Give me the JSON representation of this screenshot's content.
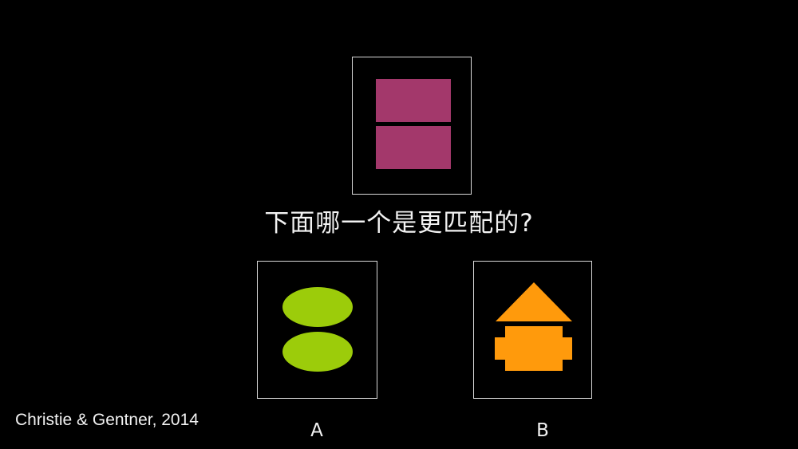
{
  "question": "下面哪一个是更匹配的?",
  "choices": {
    "a_label": "A",
    "b_label": "B"
  },
  "citation": "Christie & Gentner, 2014",
  "figures": {
    "target": {
      "shape": "two stacked rectangles",
      "color": "#a3386b"
    },
    "option_a": {
      "shape": "two stacked ellipses",
      "color": "#9ccc0a"
    },
    "option_b": {
      "shape": "triangle above cross-shaped block",
      "color": "#ff9a0c"
    }
  },
  "colors": {
    "background": "#000000",
    "border": "#d9d9d9",
    "text": "#f2f2f2"
  }
}
